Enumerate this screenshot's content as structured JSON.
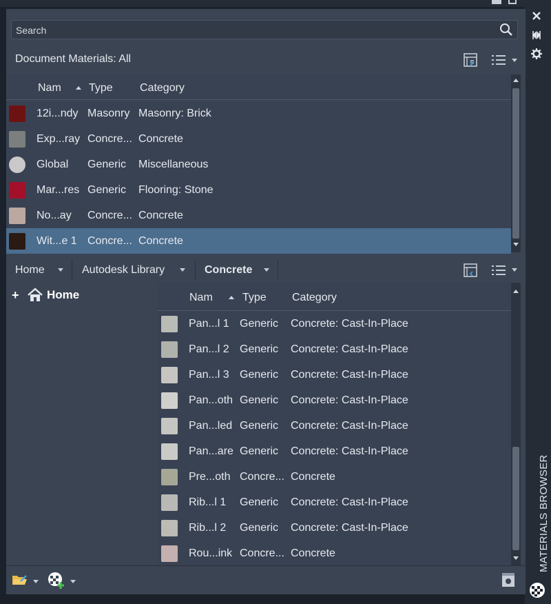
{
  "search": {
    "placeholder": "Search"
  },
  "doc_materials": {
    "title": "Document Materials: All"
  },
  "upper_table": {
    "columns": [
      "Nam",
      "Type",
      "Category"
    ],
    "rows": [
      {
        "name": "12i...ndy",
        "type": "Masonry",
        "category": "Masonry: Brick",
        "swatch": "#6d1212"
      },
      {
        "name": "Exp...ray",
        "type": "Concre...",
        "category": "Concrete",
        "swatch": "#7b7f7d"
      },
      {
        "name": "Global",
        "type": "Generic",
        "category": "Miscellaneous",
        "swatch": "#c9c9c9"
      },
      {
        "name": "Mar...res",
        "type": "Generic",
        "category": "Flooring: Stone",
        "swatch": "#a3102a"
      },
      {
        "name": "No...ay",
        "type": "Concre...",
        "category": "Concrete",
        "swatch": "#bba8a0"
      },
      {
        "name": "Wit...e 1",
        "type": "Concre...",
        "category": "Concrete",
        "swatch": "#2a1a12"
      }
    ],
    "selected_index": 5
  },
  "library_bar": {
    "items": [
      "Home",
      "Autodesk Library",
      "Concrete"
    ],
    "active_index": 2
  },
  "tree": {
    "home_label": "Home"
  },
  "lower_table": {
    "columns": [
      "Nam",
      "Type",
      "Category"
    ],
    "rows": [
      {
        "name": "Pan...l 1",
        "type": "Generic",
        "category": "Concrete: Cast-In-Place",
        "swatch": "#b9bbb5"
      },
      {
        "name": "Pan...l 2",
        "type": "Generic",
        "category": "Concrete: Cast-In-Place",
        "swatch": "#b0b3ac"
      },
      {
        "name": "Pan...l 3",
        "type": "Generic",
        "category": "Concrete: Cast-In-Place",
        "swatch": "#c6c5c0"
      },
      {
        "name": "Pan...oth",
        "type": "Generic",
        "category": "Concrete: Cast-In-Place",
        "swatch": "#cfd0cc"
      },
      {
        "name": "Pan...led",
        "type": "Generic",
        "category": "Concrete: Cast-In-Place",
        "swatch": "#c5c6c1"
      },
      {
        "name": "Pan...are",
        "type": "Generic",
        "category": "Concrete: Cast-In-Place",
        "swatch": "#cacbc7"
      },
      {
        "name": "Pre...oth",
        "type": "Concre...",
        "category": "Concrete",
        "swatch": "#a7a796"
      },
      {
        "name": "Rib...l 1",
        "type": "Generic",
        "category": "Concrete: Cast-In-Place",
        "swatch": "#b8b9b4"
      },
      {
        "name": "Rib...l 2",
        "type": "Generic",
        "category": "Concrete: Cast-In-Place",
        "swatch": "#bcbbb5"
      },
      {
        "name": "Rou...ink",
        "type": "Concre...",
        "category": "Concrete",
        "swatch": "#c4b0ae"
      }
    ]
  },
  "palette_title": "MATERIALS BROWSER",
  "colors": {
    "selection": "#4b6d8e",
    "panel": "#3b4453",
    "list": "#394253",
    "chrome": "#252c36"
  },
  "icons": {
    "search": "search-icon",
    "view_toggle": "list-view-icon",
    "view_options": "view-options-icon",
    "close": "close-icon",
    "autohide": "autohide-icon",
    "settings": "gear-icon",
    "open_library": "open-library-icon",
    "create_material": "create-material-icon",
    "editor": "material-editor-icon",
    "home": "home-icon"
  }
}
